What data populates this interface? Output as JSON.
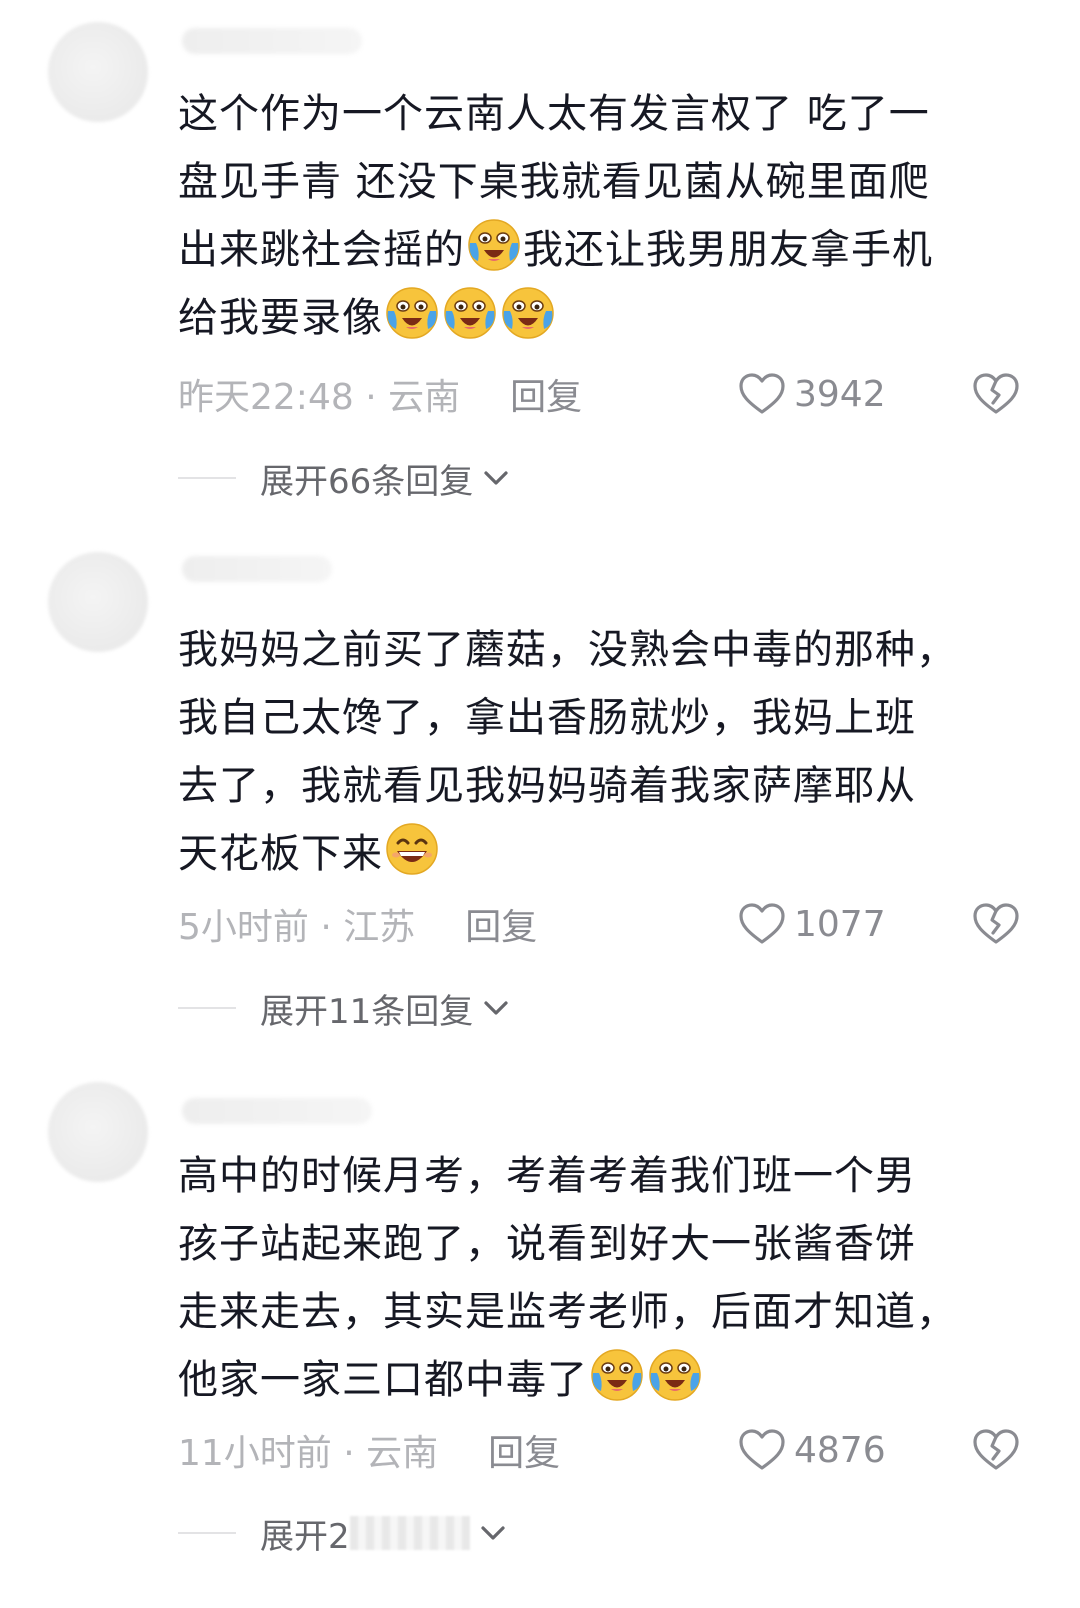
{
  "comments": [
    {
      "text_lines": [
        "这个作为一个云南人太有发言权了 吃了一",
        "盘见手青 还没下桌我就看见菌从碗里面爬",
        "出来跳社会摇的",
        "我还让我男朋友拿手机",
        "给我要录像"
      ],
      "emoji_1": "cry-laugh-emoji",
      "time": "昨天22:48",
      "location": "云南",
      "reply_label": "回复",
      "likes": "3942",
      "expand_label": "展开66条回复"
    },
    {
      "text_lines": [
        "我妈妈之前买了蘑菇，没熟会中毒的那种，",
        "我自己太馋了，拿出香肠就炒，我妈上班",
        "去了，我就看见我妈妈骑着我家萨摩耶从",
        "天花板下来"
      ],
      "emoji_1": "grin-emoji",
      "time": "5小时前",
      "location": "江苏",
      "reply_label": "回复",
      "likes": "1077",
      "expand_label": "展开11条回复"
    },
    {
      "text_lines": [
        "高中的时候月考，考着考着我们班一个男",
        "孩子站起来跑了，说看到好大一张酱香饼",
        "走来走去，其实是监考老师，后面才知道，",
        "他家一家三口都中毒了"
      ],
      "emoji_1": "cry-laugh-emoji",
      "time": "11小时前",
      "location": "云南",
      "reply_label": "回复",
      "likes": "4876",
      "expand_label": "展开2"
    }
  ],
  "separator": " · ",
  "colors": {
    "text": "#161823",
    "meta": "#a8a9ad",
    "expand": "#66676c",
    "emoji_face": "#f7c43c",
    "emoji_tear": "#4aa3e8"
  }
}
